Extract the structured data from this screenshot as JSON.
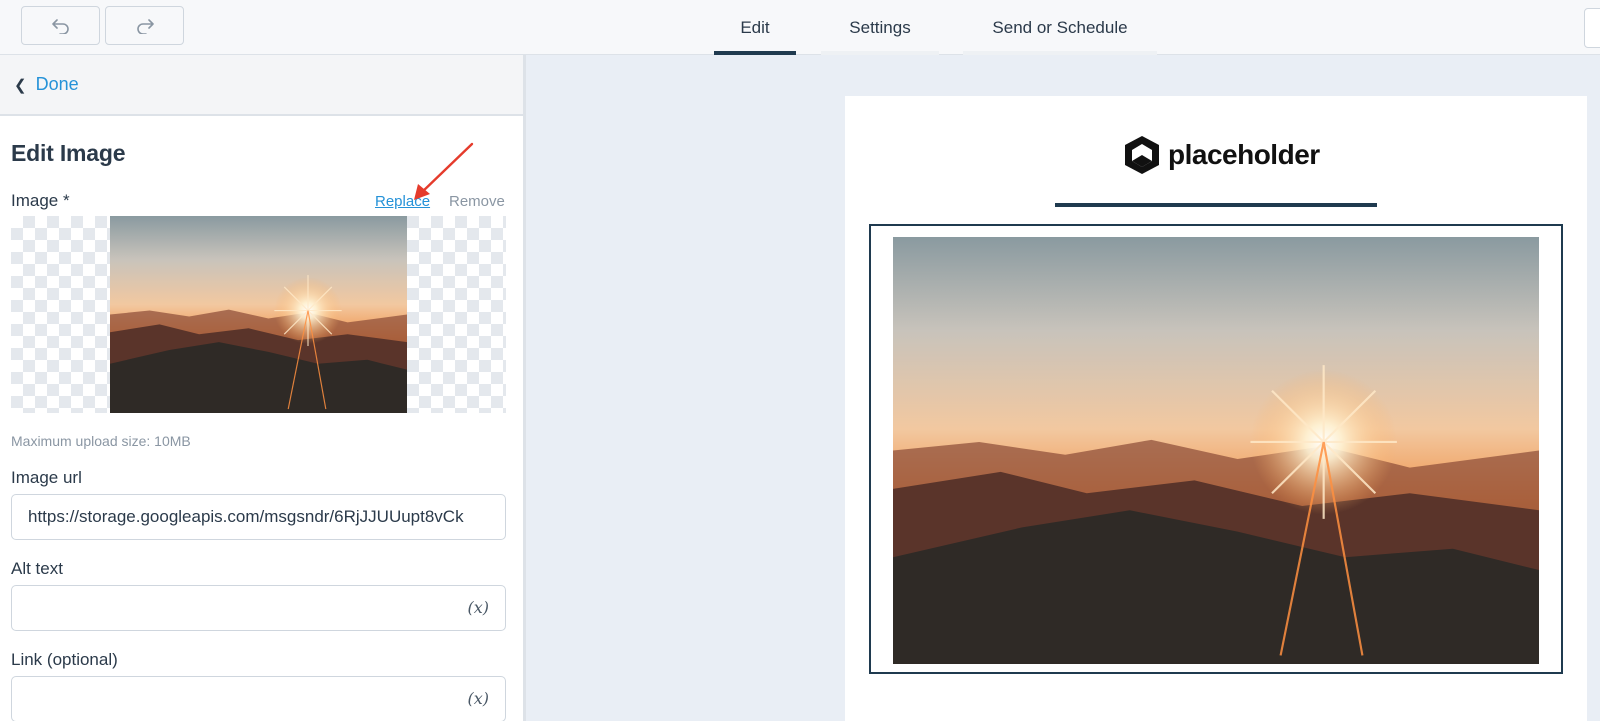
{
  "toolbar": {
    "undo_icon": "undo-icon",
    "redo_icon": "redo-icon",
    "tabs": [
      {
        "label": "Edit",
        "active": true
      },
      {
        "label": "Settings",
        "active": false
      },
      {
        "label": "Send or Schedule",
        "active": false
      }
    ]
  },
  "panel": {
    "back_label": "Done",
    "title": "Edit Image",
    "image_label": "Image *",
    "replace_label": "Replace",
    "remove_label": "Remove",
    "upload_hint": "Maximum upload size: 10MB",
    "image_url_label": "Image url",
    "image_url_value": "https://storage.googleapis.com/msgsndr/6RjJJUUupt8vCk",
    "alt_text_label": "Alt text",
    "alt_text_value": "",
    "link_label": "Link (optional)",
    "link_value": "",
    "variable_icon": "(x)"
  },
  "canvas": {
    "logo_text": "placeholder"
  },
  "colors": {
    "accent": "#2592d8",
    "dark": "#1f3a4f",
    "annotation": "#e53b2c"
  }
}
